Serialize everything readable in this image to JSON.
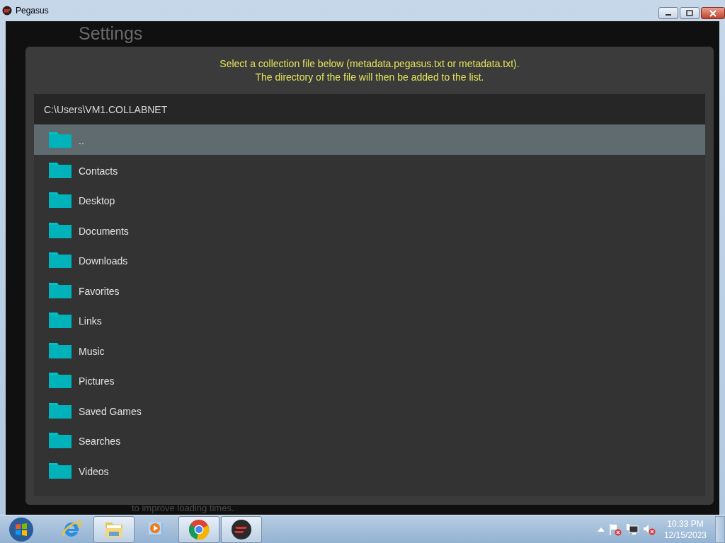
{
  "window": {
    "title": "Pegasus"
  },
  "background": {
    "heading": "Settings",
    "note": "to improve loading times."
  },
  "dialog": {
    "message": [
      "Select a collection file below (metadata.pegasus.txt or metadata.txt).",
      "The directory of the file will then be added to the list."
    ],
    "path": "C:\\Users\\VM1.COLLABNET",
    "entries": [
      {
        "name": "..",
        "selected": true
      },
      {
        "name": "Contacts",
        "selected": false
      },
      {
        "name": "Desktop",
        "selected": false
      },
      {
        "name": "Documents",
        "selected": false
      },
      {
        "name": "Downloads",
        "selected": false
      },
      {
        "name": "Favorites",
        "selected": false
      },
      {
        "name": "Links",
        "selected": false
      },
      {
        "name": "Music",
        "selected": false
      },
      {
        "name": "Pictures",
        "selected": false
      },
      {
        "name": "Saved Games",
        "selected": false
      },
      {
        "name": "Searches",
        "selected": false
      },
      {
        "name": "Videos",
        "selected": false
      }
    ]
  },
  "taskbar": {
    "apps": [
      {
        "kind": "ie",
        "running": false
      },
      {
        "kind": "explorer",
        "running": true
      },
      {
        "kind": "media",
        "running": false
      },
      {
        "kind": "chrome",
        "running": true
      },
      {
        "kind": "pegasus",
        "running": true
      }
    ],
    "clock": {
      "time": "10:33 PM",
      "date": "12/15/2023"
    }
  }
}
